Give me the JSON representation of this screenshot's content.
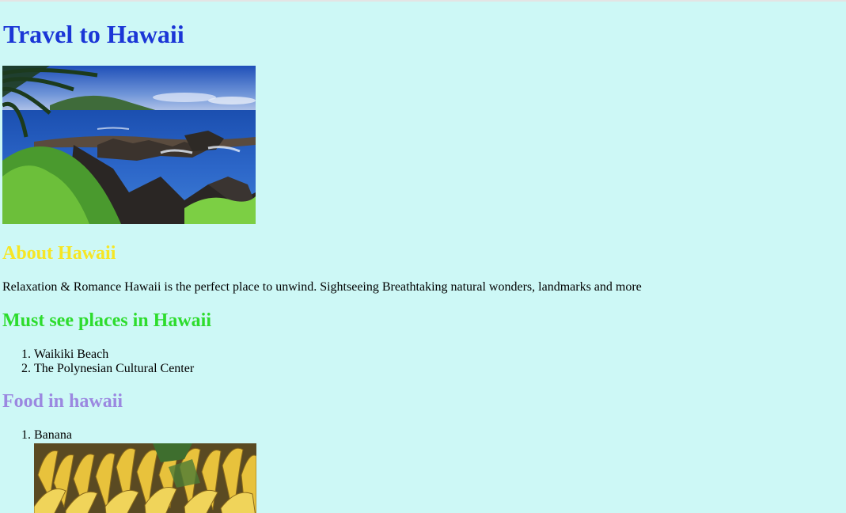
{
  "page": {
    "title": "Travel to Hawaii"
  },
  "about": {
    "heading": "About Hawaii",
    "text": "Relaxation & Romance Hawaii is the perfect place to unwind. Sightseeing Breathtaking natural wonders, landmarks and more"
  },
  "places": {
    "heading": "Must see places in Hawaii",
    "items": [
      {
        "num": "1.",
        "label": "Waikiki Beach"
      },
      {
        "num": "2.",
        "label": "The Polynesian Cultural Center"
      }
    ]
  },
  "food": {
    "heading": "Food in hawaii",
    "items": [
      {
        "num": "1.",
        "label": "Banana"
      }
    ]
  },
  "colors": {
    "background": "#cdf8f6",
    "title": "#1b36d6",
    "about_heading": "#f6e624",
    "places_heading": "#2ddc2d",
    "food_heading": "#9b88e0"
  },
  "images": {
    "hero": "hawaii-coast-photo",
    "banana": "banana-bunch-photo"
  }
}
